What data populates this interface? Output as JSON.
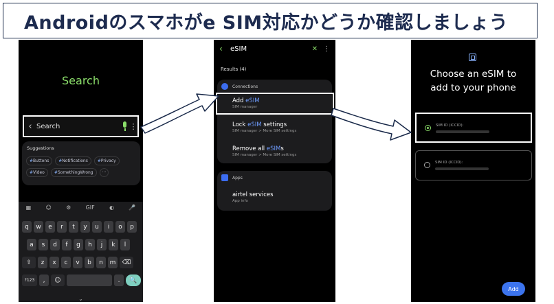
{
  "banner": {
    "text": "Androidのスマホがe SIM対応かどうか確認しましょう"
  },
  "phone1": {
    "title": "Search",
    "search_label": "Search",
    "suggestions_title": "Suggestions",
    "chips": [
      "Buttons",
      "Notifications",
      "Privacy",
      "Video",
      "SomethingWrong"
    ],
    "more": "···",
    "keyboard": {
      "tools": [
        "▦",
        "☺",
        "⚙",
        "GIF",
        "◐",
        "🎤"
      ],
      "row1": [
        "q",
        "w",
        "e",
        "r",
        "t",
        "y",
        "u",
        "i",
        "o",
        "p"
      ],
      "row2": [
        "a",
        "s",
        "d",
        "f",
        "g",
        "h",
        "j",
        "k",
        "l"
      ],
      "row3": [
        "⇧",
        "z",
        "x",
        "c",
        "v",
        "b",
        "n",
        "m",
        "⌫"
      ],
      "row4": [
        "?123",
        ",",
        "☺",
        "",
        ".",
        "🔍"
      ]
    }
  },
  "phone2": {
    "title": "eSIM",
    "results": "Results (4)",
    "connections": "Connections",
    "items": [
      {
        "pre": "Add ",
        "hl": "eSIM",
        "post": "",
        "sub": "SIM manager"
      },
      {
        "pre": "Lock ",
        "hl": "eSIM",
        "post": " settings",
        "sub": "SIM manager > More SIM settings"
      },
      {
        "pre": "Remove all ",
        "hl": "eSIM",
        "post": "s",
        "sub": "SIM manager > More SIM settings"
      }
    ],
    "apps": "Apps",
    "app_item": {
      "title": "airtel services",
      "sub": "App info"
    }
  },
  "phone3": {
    "title_line1": "Choose an eSIM to",
    "title_line2": "add to your phone",
    "option_label": "SIM ID (ICCID):",
    "add": "Add"
  },
  "colors": {
    "accent_green": "#8bde6a",
    "link_blue": "#6f9cff",
    "button_blue": "#3c74ee",
    "banner_text": "#1d2b4f"
  }
}
